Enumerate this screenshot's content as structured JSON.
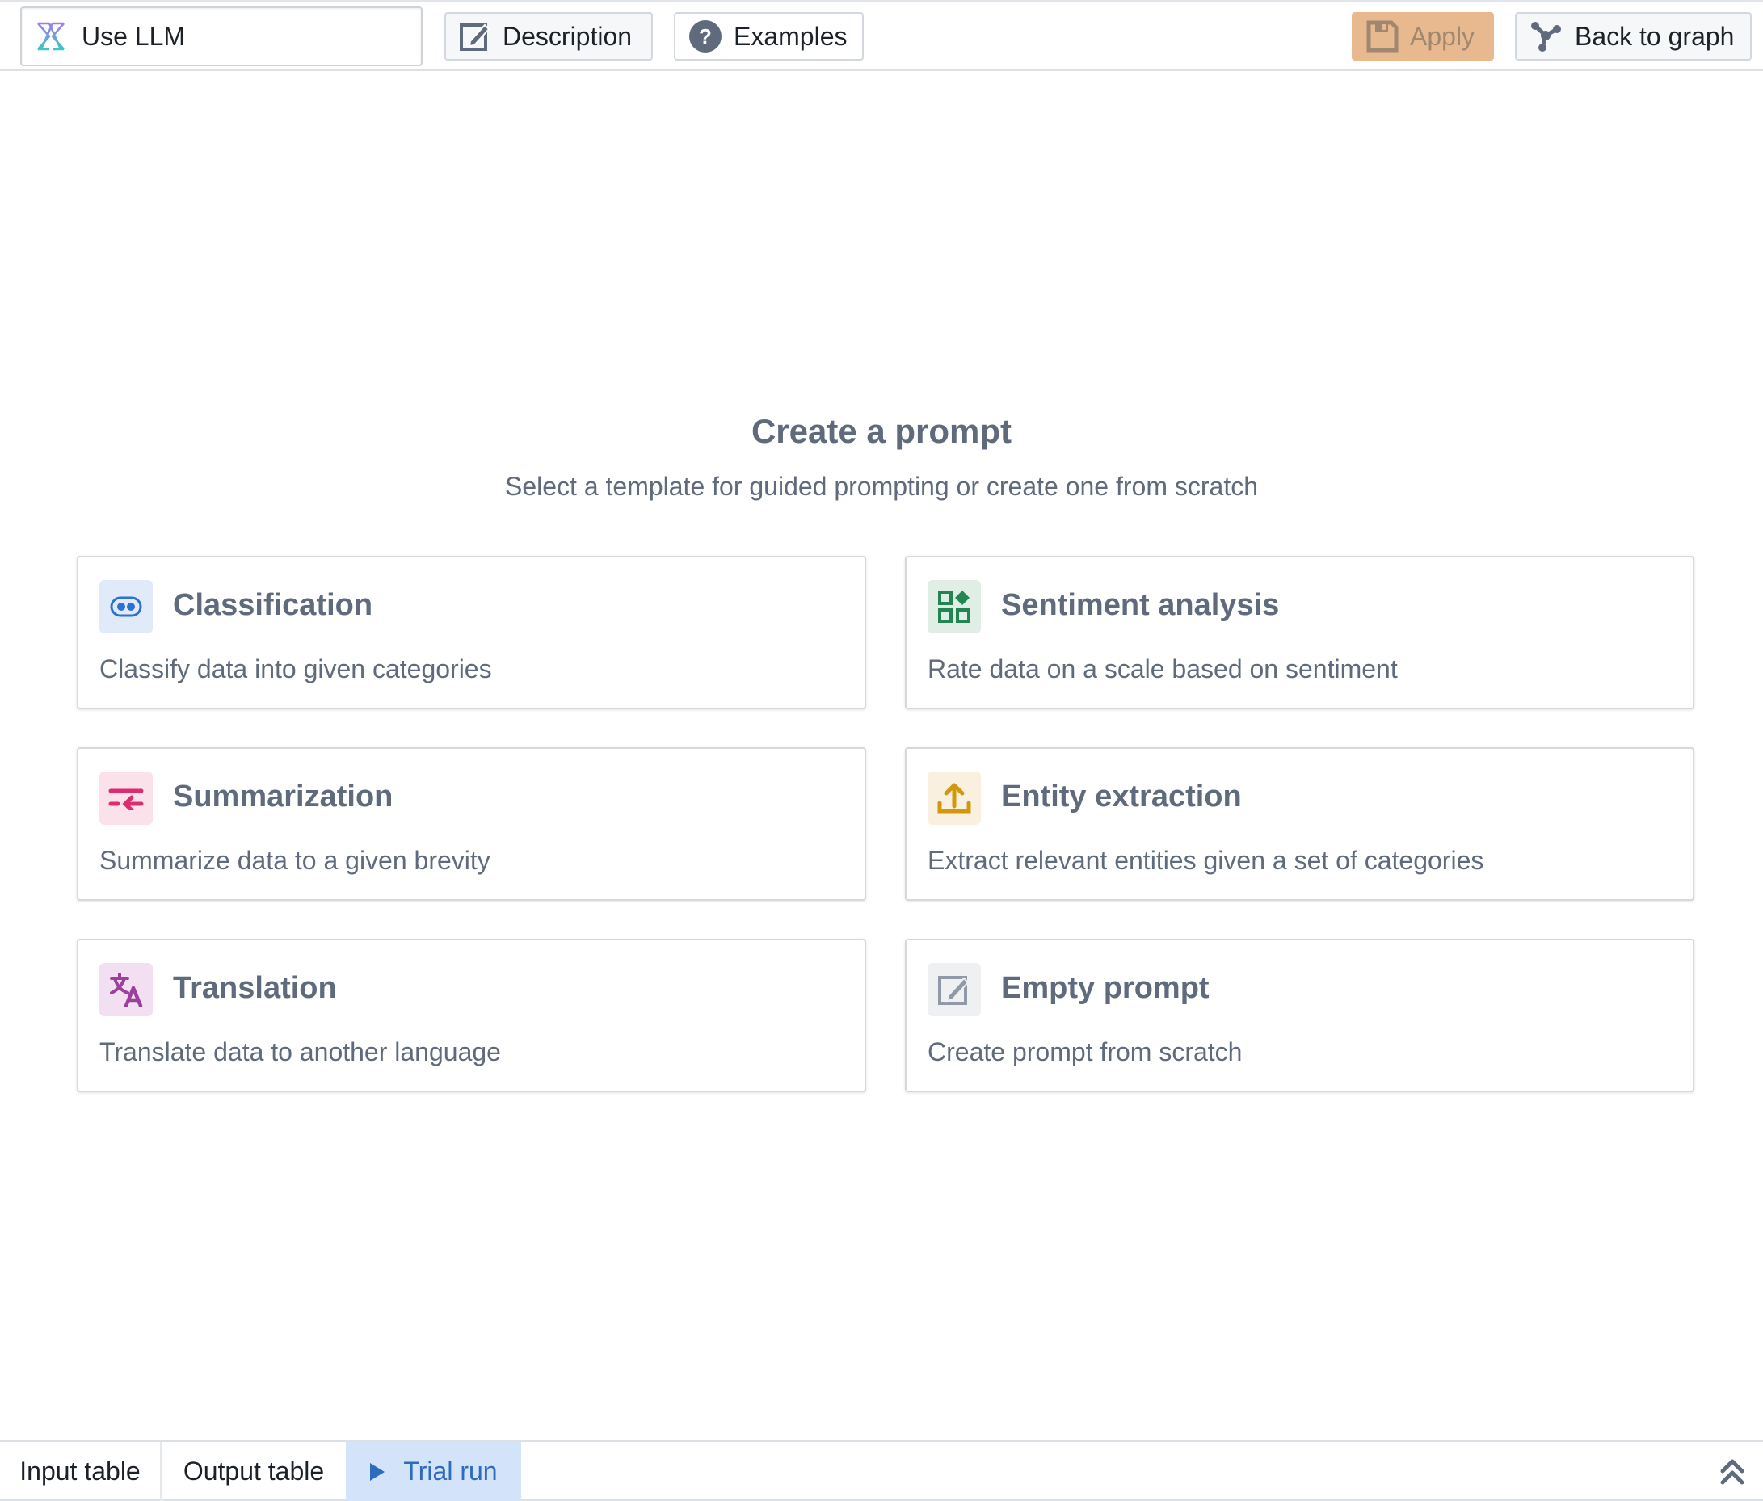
{
  "toolbar": {
    "name_field": {
      "value": "Use LLM",
      "icon": "llm-logo-icon"
    },
    "description_label": "Description",
    "examples_label": "Examples",
    "apply_label": "Apply",
    "back_label": "Back to graph"
  },
  "main": {
    "title": "Create a prompt",
    "subtitle": "Select a template for guided prompting or create one from scratch",
    "templates": [
      {
        "title": "Classification",
        "description": "Classify data into given categories",
        "icon": "classification-icon",
        "color": "#2d72d2",
        "bg": "#e1eaf8"
      },
      {
        "title": "Sentiment analysis",
        "description": "Rate data on a scale based on sentiment",
        "icon": "sentiment-icon",
        "color": "#238551",
        "bg": "#e0eee6"
      },
      {
        "title": "Summarization",
        "description": "Summarize data to a given brevity",
        "icon": "summarization-icon",
        "color": "#db2c6f",
        "bg": "#fbe2ea"
      },
      {
        "title": "Entity extraction",
        "description": "Extract relevant entities given a set of categories",
        "icon": "extraction-icon",
        "color": "#d1980b",
        "bg": "#f9f0df"
      },
      {
        "title": "Translation",
        "description": "Translate data to another language",
        "icon": "translation-icon",
        "color": "#9d3f9d",
        "bg": "#f2e0f2"
      },
      {
        "title": "Empty prompt",
        "description": "Create prompt from scratch",
        "icon": "edit-icon",
        "color": "#8f99a8",
        "bg": "#eef0f2"
      }
    ]
  },
  "bottom": {
    "tabs": [
      {
        "label": "Input table"
      },
      {
        "label": "Output table"
      },
      {
        "label": "Trial run",
        "active": true
      }
    ]
  }
}
